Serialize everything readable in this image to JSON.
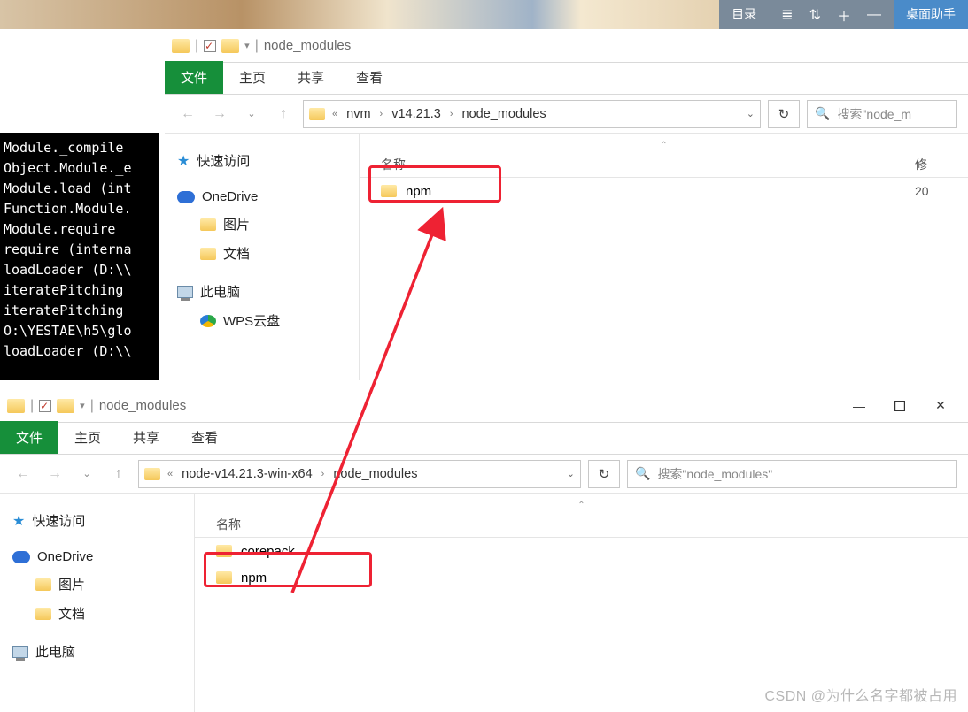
{
  "desktop": {
    "catalog": "目录",
    "helper": "桌面助手"
  },
  "terminal_lines": "Module._compile \nObject.Module._e\nModule.load (int\nFunction.Module.\nModule.require  \nrequire (interna\nloadLoader (D:\\\\\niteratePitching\niteratePitching\nO:\\YESTAE\\h5\\glo\nloadLoader (D:\\\\",
  "win1": {
    "title": "node_modules",
    "ribbon": {
      "file": "文件",
      "home": "主页",
      "share": "共享",
      "view": "查看"
    },
    "path": {
      "root": "nvm",
      "sub1": "v14.21.3",
      "sub2": "node_modules"
    },
    "column_name": "名称",
    "column_date": "修",
    "search_placeholder": "搜索\"node_m",
    "rows": [
      {
        "name": "npm",
        "date": "20"
      }
    ],
    "sidebar": {
      "quick": "快速访问",
      "onedrive": "OneDrive",
      "pictures": "图片",
      "documents": "文档",
      "thispc": "此电脑",
      "wps": "WPS云盘"
    }
  },
  "win2": {
    "title": "node_modules",
    "ribbon": {
      "file": "文件",
      "home": "主页",
      "share": "共享",
      "view": "查看"
    },
    "path": {
      "root": "node-v14.21.3-win-x64",
      "sub1": "node_modules"
    },
    "column_name": "名称",
    "search_placeholder": "搜索\"node_modules\"",
    "rows": [
      {
        "name": "corepack"
      },
      {
        "name": "npm"
      }
    ],
    "sidebar": {
      "quick": "快速访问",
      "onedrive": "OneDrive",
      "pictures": "图片",
      "documents": "文档",
      "thispc": "此电脑"
    }
  },
  "watermark": "CSDN @为什么名字都被占用"
}
